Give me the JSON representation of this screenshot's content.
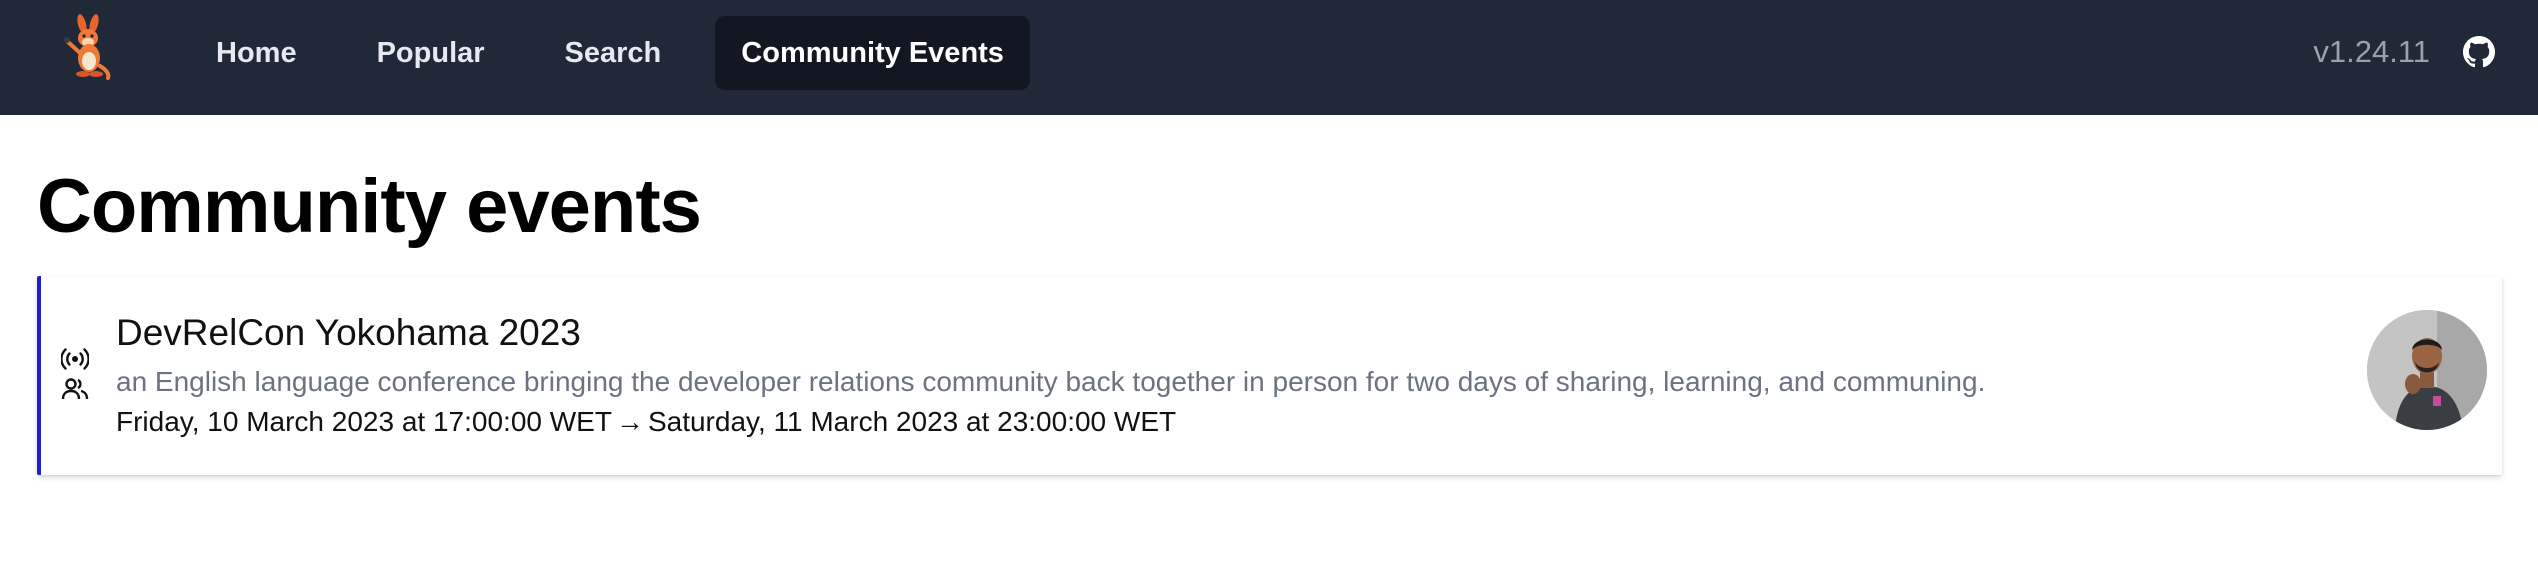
{
  "nav": {
    "logo_icon": "kangaroo-mascot-icon",
    "links": [
      "Home",
      "Popular",
      "Search",
      "Community Events"
    ],
    "active": "Community Events",
    "version": "v1.24.11",
    "github_icon": "github-icon"
  },
  "page": {
    "title": "Community events"
  },
  "event": {
    "title": "DevRelCon Yokohama 2023",
    "description": "an English language conference bringing the developer relations community back together in person for two days of sharing, learning, and communing.",
    "start": "Friday, 10 March 2023 at 17:00:00 WET",
    "separator": "→",
    "end": "Saturday, 11 March 2023 at 23:00:00 WET",
    "icons": [
      "broadcast-icon",
      "people-icon"
    ],
    "accent_color": "#1d1fd1"
  },
  "colors": {
    "navbar_bg": "#212837",
    "active_tab_bg": "#121722"
  }
}
